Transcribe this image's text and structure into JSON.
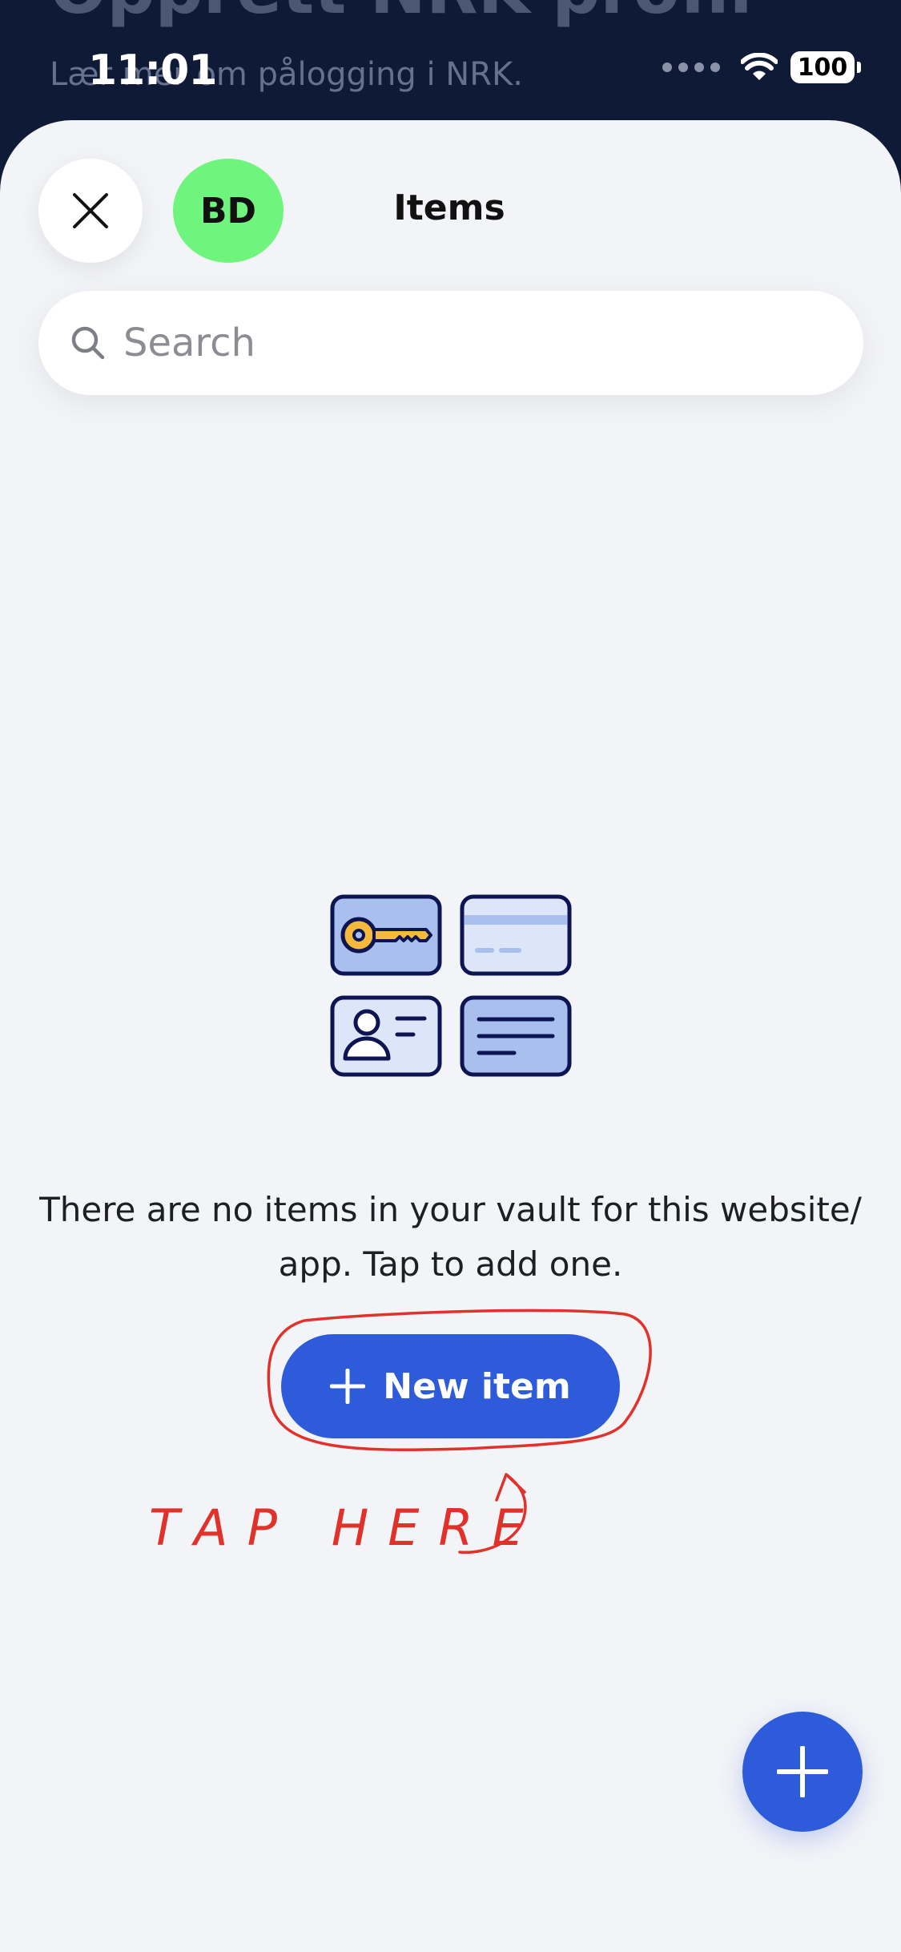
{
  "background": {
    "title": "Opprett NRK-profil",
    "subtitle": "Lær mer om pålogging i NRK."
  },
  "status_bar": {
    "time": "11:01",
    "battery": "100",
    "wifi_icon": "wifi-icon"
  },
  "header": {
    "close_icon": "close-icon",
    "avatar_initials": "BD",
    "title": "Items"
  },
  "search": {
    "placeholder": "Search",
    "icon": "search-icon"
  },
  "empty_state": {
    "illustration_icons": [
      "key-card-icon",
      "credit-card-icon",
      "identity-card-icon",
      "note-card-icon"
    ],
    "message": "There are no items in your vault for this website/ app. Tap to add one.",
    "button_label": "New item"
  },
  "annotation": {
    "text": "TAP HERE",
    "color": "#e0322a"
  },
  "fab": {
    "icon": "plus-icon"
  },
  "colors": {
    "accent": "#2d5bd9",
    "avatar": "#6ff47d",
    "header_bg": "#0e1a36",
    "sheet_bg": "#f3f4f8"
  }
}
